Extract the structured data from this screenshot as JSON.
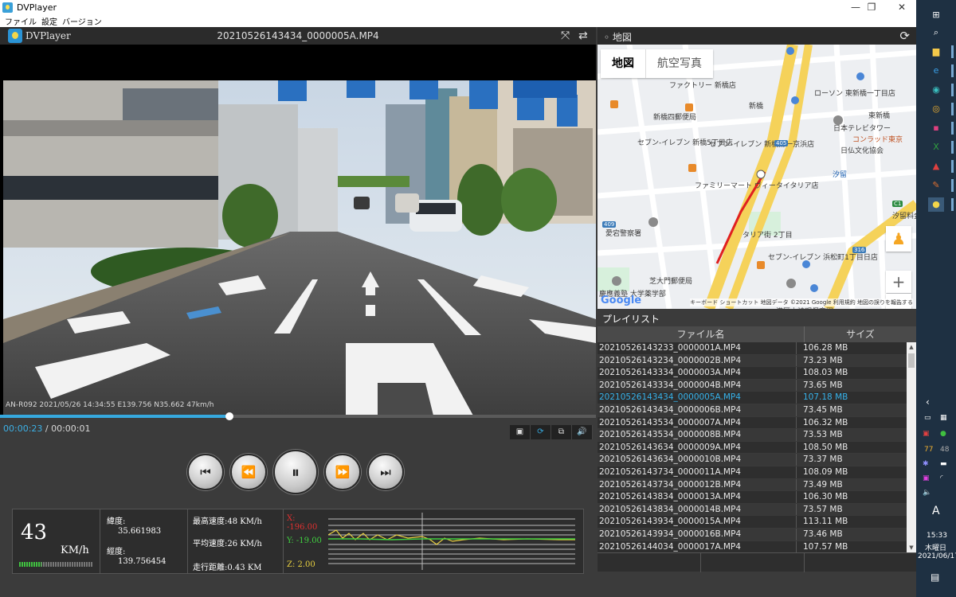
{
  "window": {
    "title": "DVPlayer",
    "controls": [
      "—",
      "❐",
      "✕"
    ]
  },
  "menu": [
    "ファイル",
    "設定",
    "バージョン"
  ],
  "player": {
    "brand": "DVPlayer",
    "filename": "20210526143434_0000005A.MP4",
    "osd": "AN-R092 2021/05/26 14:34:55     E139.756 N35.662     47km/h",
    "current_time": "00:00:23",
    "total_time": " / 00:00:01",
    "progress": 0.385,
    "mini_buttons": [
      "▣",
      "⟳",
      "⧉",
      "🔊"
    ]
  },
  "stats": {
    "speed": "43",
    "speed_unit": "KM/h",
    "speed_level": 0.3,
    "latitude_label": "緯度:",
    "latitude": "35.661983",
    "longitude_label": "經度:",
    "longitude": "139.756454",
    "max_speed": "最高速度:48 KM/h",
    "avg_speed": "平均速度:26 KM/h",
    "distance": "走行距離:0.43 KM",
    "x_label": "X: -196.00",
    "y_label": "Y: -19.00",
    "z_label": "Z: 2.00",
    "x_color": "#e03030",
    "y_color": "#40d040",
    "z_color": "#e8d040"
  },
  "map": {
    "header": "地図",
    "tabs": [
      "地図",
      "航空写真"
    ],
    "google": "Google",
    "attribution": "キーボード ショートカット  地図データ ©2021 Google  利用規約  地図の誤りを報告する",
    "labels": [
      "ファクトリー 新橋店",
      "ローソン 東新橋一丁目店",
      "新橋",
      "新橋四郵便局",
      "東新橋",
      "日本テレビタワー",
      "コンラッド東京",
      "セブン-イレブン 新橋5丁目店",
      "セブン-イレブン 新橋第一京浜店",
      "日仏文化協会",
      "汐留",
      "ファミリーマート ヴィータイタリア店",
      "汐留料金所",
      "愛宕警察署",
      "タリア街 2丁目",
      "セブン-イレブン 浜松町1丁目日店",
      "芝大門郵便局",
      "慶應義塾 大学薬学部",
      "港区立神明保育園",
      "アスク汐留保"
    ],
    "road_numbers": [
      "405",
      "409",
      "316",
      "C1"
    ]
  },
  "playlist": {
    "header": "プレイリスト",
    "col_name": "ファイル名",
    "col_size": "サイズ",
    "selected_index": 4,
    "rows": [
      {
        "name": "20210526143233_0000001A.MP4",
        "size": "106.28 MB"
      },
      {
        "name": "20210526143234_0000002B.MP4",
        "size": "73.23 MB"
      },
      {
        "name": "20210526143334_0000003A.MP4",
        "size": "108.03 MB"
      },
      {
        "name": "20210526143334_0000004B.MP4",
        "size": "73.65 MB"
      },
      {
        "name": "20210526143434_0000005A.MP4",
        "size": "107.18 MB"
      },
      {
        "name": "20210526143434_0000006B.MP4",
        "size": "73.45 MB"
      },
      {
        "name": "20210526143534_0000007A.MP4",
        "size": "106.32 MB"
      },
      {
        "name": "20210526143534_0000008B.MP4",
        "size": "73.53 MB"
      },
      {
        "name": "20210526143634_0000009A.MP4",
        "size": "108.50 MB"
      },
      {
        "name": "20210526143634_0000010B.MP4",
        "size": "73.37 MB"
      },
      {
        "name": "20210526143734_0000011A.MP4",
        "size": "108.09 MB"
      },
      {
        "name": "20210526143734_0000012B.MP4",
        "size": "73.49 MB"
      },
      {
        "name": "20210526143834_0000013A.MP4",
        "size": "106.30 MB"
      },
      {
        "name": "20210526143834_0000014B.MP4",
        "size": "73.57 MB"
      },
      {
        "name": "20210526143934_0000015A.MP4",
        "size": "113.11 MB"
      },
      {
        "name": "20210526143934_0000016B.MP4",
        "size": "73.46 MB"
      },
      {
        "name": "20210526144034_0000017A.MP4",
        "size": "107.57 MB"
      }
    ]
  },
  "taskbar": {
    "time": "15:33",
    "weekday": "木曜日",
    "date": "2021/06/17",
    "ime": "A",
    "num1": "77",
    "num2": "48"
  }
}
